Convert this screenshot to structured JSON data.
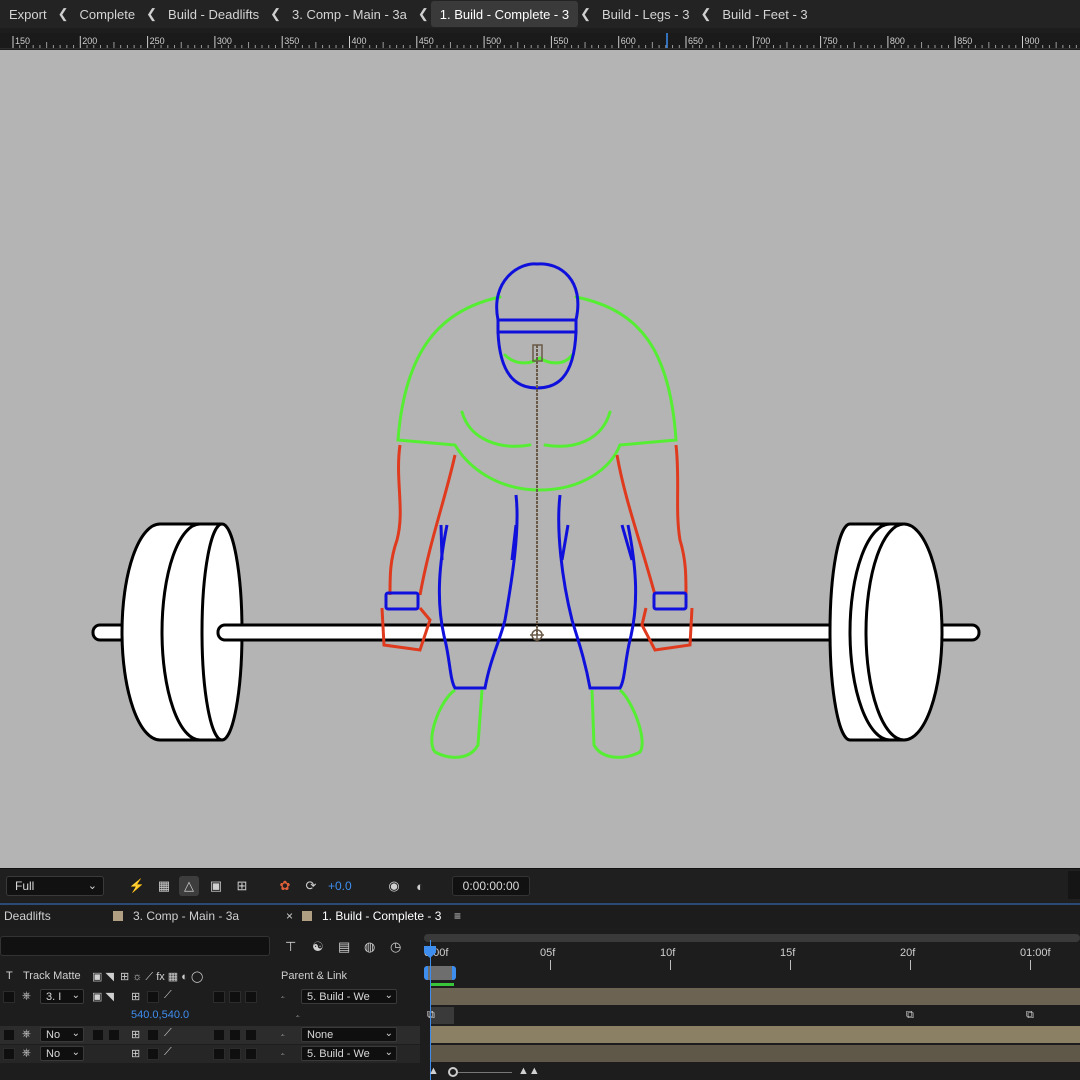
{
  "breadcrumbs": [
    {
      "label": "Export"
    },
    {
      "label": "Complete"
    },
    {
      "label": "Build - Deadlifts"
    },
    {
      "label": "3. Comp - Main - 3a"
    },
    {
      "label": "1. Build - Complete - 3",
      "active": true
    },
    {
      "label": "Build - Legs - 3"
    },
    {
      "label": "Build - Feet - 3"
    }
  ],
  "ruler": {
    "labels": [
      "150",
      "200",
      "250",
      "300",
      "350",
      "400",
      "450",
      "500",
      "550",
      "600",
      "650",
      "700",
      "750",
      "800",
      "850",
      "900"
    ]
  },
  "viewer_toolbar": {
    "resolution": "Full",
    "exposure": "+0.0",
    "timecode": "0:00:00:00",
    "icons": [
      "fast-previews-icon",
      "transparency-grid-icon",
      "mask-path-icon",
      "safe-margins-icon",
      "grid-guides-icon",
      "color-channels-icon",
      "reset-exposure-icon",
      "snapshot-icon",
      "show-snapshot-icon"
    ]
  },
  "timeline_tabs": [
    {
      "label": "Deadlifts"
    },
    {
      "label": "3. Comp - Main - 3a"
    },
    {
      "label": "1. Build - Complete - 3",
      "active": true
    }
  ],
  "timeline": {
    "columns": {
      "t": "T",
      "track_matte": "Track Matte",
      "parent_link": "Parent & Link"
    },
    "layers": [
      {
        "matte": "3. I",
        "parent": "5. Build - We"
      },
      {
        "property_value": "540.0,540.0"
      },
      {
        "matte": "No",
        "parent": "None"
      },
      {
        "matte": "No",
        "parent": "5. Build - We"
      }
    ],
    "ruler_labels": [
      "0:00f",
      "05f",
      "10f",
      "15f",
      "20f",
      "01:00f"
    ]
  },
  "colors": {
    "accent": "#3e8ef0",
    "canvas_bg": "#b4b4b4",
    "outline_blue": "#1010dd",
    "outline_green": "#55ee33",
    "outline_red": "#e03a1e"
  }
}
